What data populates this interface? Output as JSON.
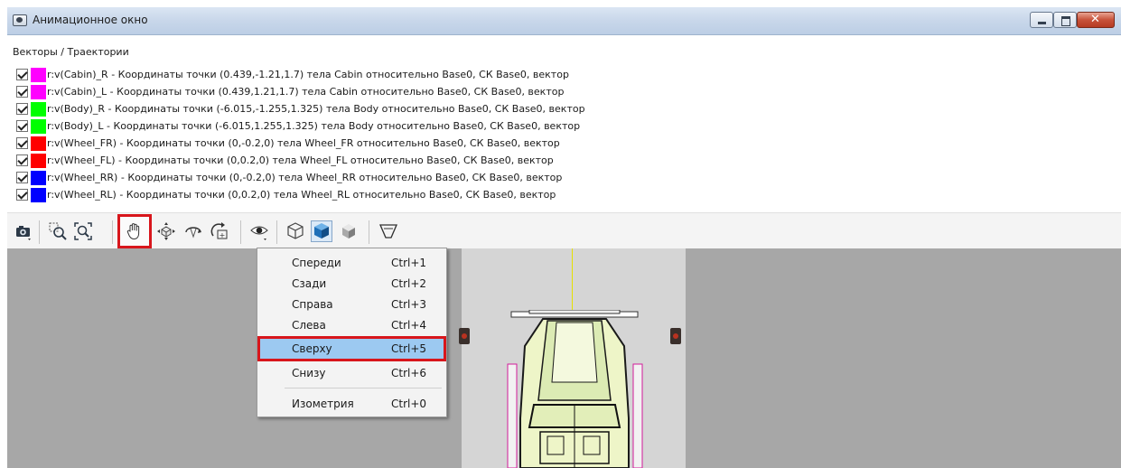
{
  "window": {
    "title": "Анимационное окно",
    "icon": "animation-window-icon",
    "controls": [
      "minimize-icon",
      "maximize-icon",
      "close-icon"
    ]
  },
  "vectors_panel": {
    "title": "Векторы / Траектории",
    "items": [
      {
        "checked": true,
        "color": "#ff00ff",
        "label": "r:v(Cabin)_R - Координаты точки (0.439,-1.21,1.7) тела Cabin относительно Base0, СК Base0, вектор"
      },
      {
        "checked": true,
        "color": "#ff00ff",
        "label": "r:v(Cabin)_L - Координаты точки (0.439,1.21,1.7) тела Cabin относительно Base0, СК Base0, вектор"
      },
      {
        "checked": true,
        "color": "#00ff00",
        "label": "r:v(Body)_R - Координаты точки (-6.015,-1.255,1.325) тела Body относительно Base0, СК Base0, вектор"
      },
      {
        "checked": true,
        "color": "#00ff00",
        "label": "r:v(Body)_L - Координаты точки (-6.015,1.255,1.325) тела Body относительно Base0, СК Base0, вектор"
      },
      {
        "checked": true,
        "color": "#ff0000",
        "label": "r:v(Wheel_FR) - Координаты точки (0,-0.2,0) тела Wheel_FR относительно Base0, СК Base0, вектор"
      },
      {
        "checked": true,
        "color": "#ff0000",
        "label": "r:v(Wheel_FL) - Координаты точки (0,0.2,0) тела Wheel_FL относительно Base0, СК Base0, вектор"
      },
      {
        "checked": true,
        "color": "#0000ff",
        "label": "r:v(Wheel_RR) - Координаты точки (0,-0.2,0) тела Wheel_RR относительно Base0, СК Base0, вектор"
      },
      {
        "checked": true,
        "color": "#0000ff",
        "label": "r:v(Wheel_RL) - Координаты точки (0,0.2,0) тела Wheel_RL относительно Base0, СК Base0, вектор"
      }
    ]
  },
  "toolbar": {
    "buttons": [
      "camera-icon",
      "zoom-area-icon",
      "zoom-fit-icon",
      "pan-hand-icon",
      "rotate-3d-icon",
      "rotate-icon",
      "rotate-fixed-icon",
      "view-eye-icon",
      "wireframe-cube-icon",
      "shaded-cube-icon",
      "textured-cube-icon",
      "perspective-icon"
    ],
    "highlighted": "pan-hand-icon",
    "active": "shaded-cube-icon"
  },
  "view_menu": {
    "items": [
      {
        "label": "Спереди",
        "shortcut": "Ctrl+1"
      },
      {
        "label": "Сзади",
        "shortcut": "Ctrl+2"
      },
      {
        "label": "Справа",
        "shortcut": "Ctrl+3"
      },
      {
        "label": "Слева",
        "shortcut": "Ctrl+4"
      },
      {
        "label": "Сверху",
        "shortcut": "Ctrl+5",
        "selected": true
      },
      {
        "label": "Снизу",
        "shortcut": "Ctrl+6"
      },
      {
        "label": "Изометрия",
        "shortcut": "Ctrl+0"
      }
    ]
  },
  "colors": {
    "highlight_box": "#d8161c",
    "menu_selection": "#9cc9f1",
    "viewport_bg": "#a7a7a7",
    "road": "#d5d5d5"
  }
}
